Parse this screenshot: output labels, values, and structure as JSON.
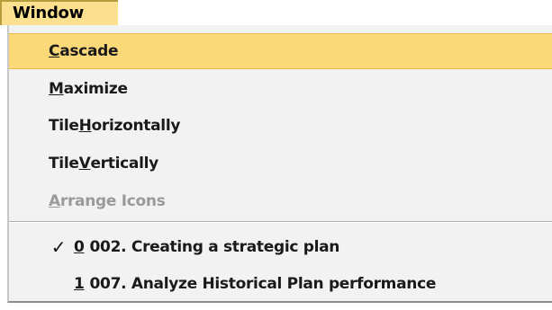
{
  "menubar": {
    "title": "Window"
  },
  "menu": {
    "items": [
      {
        "accel": "C",
        "rest": "ascade",
        "selected": true
      },
      {
        "accel": "M",
        "rest": "aximize"
      },
      {
        "pre": "Tile ",
        "accel": "H",
        "rest": "orizontally"
      },
      {
        "pre": "Tile ",
        "accel": "V",
        "rest": "ertically"
      },
      {
        "accel": "A",
        "rest": "rrange Icons",
        "disabled": true
      }
    ],
    "windows": [
      {
        "num": "0",
        "title": "002. Creating a strategic plan",
        "checked": true,
        "check_glyph": "✓"
      },
      {
        "num": "1",
        "title": "007. Analyze Historical Plan performance"
      }
    ]
  }
}
